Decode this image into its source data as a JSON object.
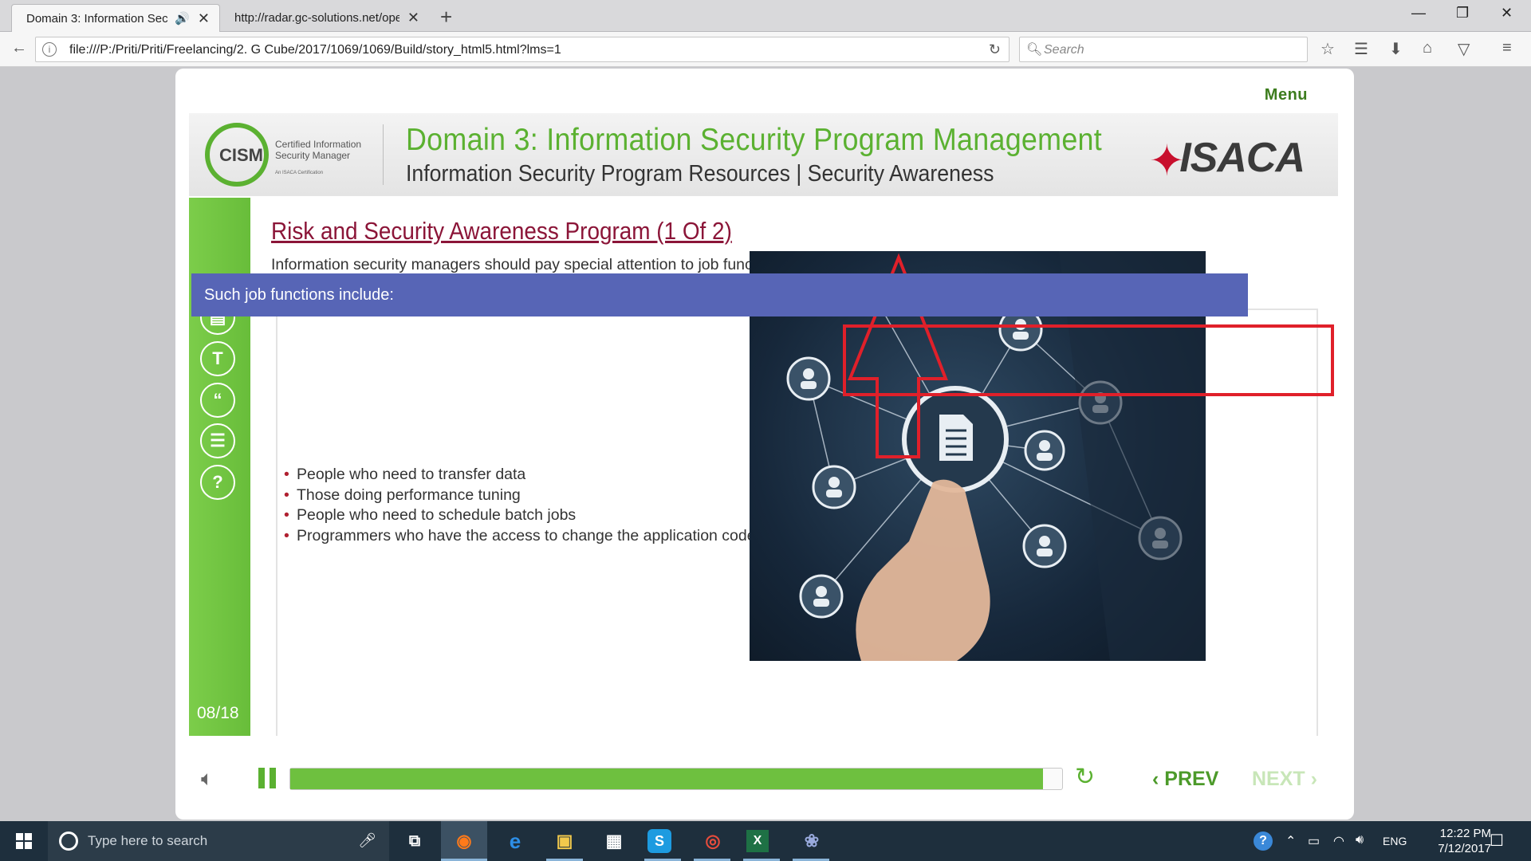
{
  "browser": {
    "tabs": [
      {
        "title": "Domain 3: Information Secu",
        "active": true
      },
      {
        "title": "http://radar.gc-solutions.net/ope",
        "active": false
      }
    ],
    "url": "file:///P:/Priti/Priti/Freelancing/2. G Cube/2017/1069/1069/Build/story_html5.html?lms=1",
    "search_placeholder": "Search"
  },
  "course": {
    "menu_label": "Menu",
    "logo": {
      "cism": "CISM",
      "cism_subtitle": "Certified Information Security Manager",
      "cism_tag": "An ISACA Certification",
      "isaca": "ISACA"
    },
    "header_title": "Domain 3: Information Security Program Management",
    "header_subtitle": "Information Security Program Resources | Security Awareness",
    "page_indicator": "08/18",
    "slide_title": "Risk and Security Awareness Program (1 Of 2)",
    "slide_description": "Information security managers should pay special attention to job functions that require high levels of data access for work carried out under limited supervision.",
    "band_label": "Such job functions include:",
    "bullets": [
      "People who need to transfer data",
      "Those doing performance tuning",
      "People who need to schedule batch jobs",
      "Programmers who have the access to change the application code"
    ],
    "progress": 0.975,
    "prev_label": "PREV",
    "next_label": "NEXT",
    "colors": {
      "green": "#5bb131",
      "band": "#5765b6",
      "title": "#8b1538",
      "highlight": "#e0202a"
    }
  },
  "taskbar": {
    "search_placeholder": "Type here to search",
    "language": "ENG",
    "time": "12:22 PM",
    "date": "7/12/2017"
  }
}
